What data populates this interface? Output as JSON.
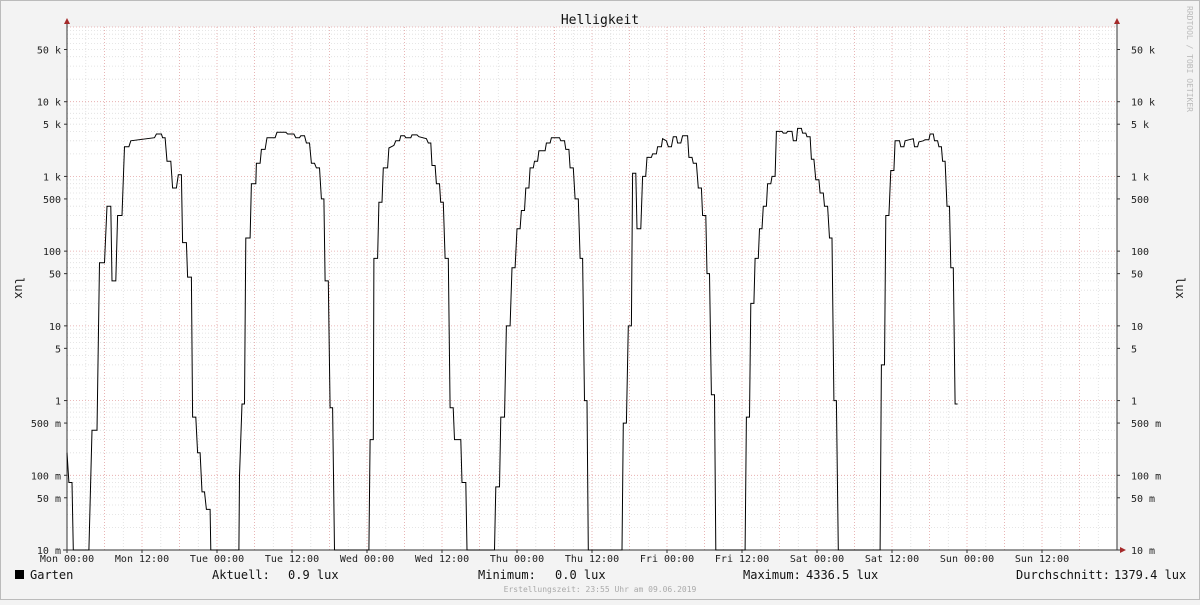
{
  "chart_data": {
    "type": "line",
    "title": "Helligkeit",
    "ylabel": "lux",
    "y_scale": "log",
    "ylim": [
      0.01,
      100000
    ],
    "xlim": [
      0,
      168
    ],
    "x_unit": "hours since Mon 00:00",
    "x_ticks": [
      {
        "x": 0,
        "label": "Mon 00:00"
      },
      {
        "x": 12,
        "label": "Mon 12:00"
      },
      {
        "x": 24,
        "label": "Tue 00:00"
      },
      {
        "x": 36,
        "label": "Tue 12:00"
      },
      {
        "x": 48,
        "label": "Wed 00:00"
      },
      {
        "x": 60,
        "label": "Wed 12:00"
      },
      {
        "x": 72,
        "label": "Thu 00:00"
      },
      {
        "x": 84,
        "label": "Thu 12:00"
      },
      {
        "x": 96,
        "label": "Fri 00:00"
      },
      {
        "x": 108,
        "label": "Fri 12:00"
      },
      {
        "x": 120,
        "label": "Sat 00:00"
      },
      {
        "x": 132,
        "label": "Sat 12:00"
      },
      {
        "x": 144,
        "label": "Sun 00:00"
      },
      {
        "x": 156,
        "label": "Sun 12:00"
      }
    ],
    "y_ticks": [
      {
        "v": 50000,
        "label": "50 k"
      },
      {
        "v": 10000,
        "label": "10 k"
      },
      {
        "v": 5000,
        "label": "5 k"
      },
      {
        "v": 1000,
        "label": "1 k"
      },
      {
        "v": 500,
        "label": "500"
      },
      {
        "v": 100,
        "label": "100"
      },
      {
        "v": 50,
        "label": "50"
      },
      {
        "v": 10,
        "label": "10"
      },
      {
        "v": 5,
        "label": "5"
      },
      {
        "v": 1,
        "label": "1"
      },
      {
        "v": 0.5,
        "label": "500 m"
      },
      {
        "v": 0.1,
        "label": "100 m"
      },
      {
        "v": 0.05,
        "label": "50 m"
      },
      {
        "v": 0.01,
        "label": "10 m"
      }
    ],
    "grid": true,
    "series": [
      {
        "name": "Garten",
        "color": "#000000",
        "points": [
          [
            0,
            0.2
          ],
          [
            0.3,
            0.08
          ],
          [
            0.8,
            0.08
          ],
          [
            1.0,
            0.01
          ],
          [
            3.5,
            0.01
          ],
          [
            4.0,
            0.4
          ],
          [
            4.8,
            0.4
          ],
          [
            5.2,
            70
          ],
          [
            6.0,
            70
          ],
          [
            6.4,
            400
          ],
          [
            7.0,
            400
          ],
          [
            7.2,
            40
          ],
          [
            7.8,
            40
          ],
          [
            8.1,
            300
          ],
          [
            8.8,
            300
          ],
          [
            9.2,
            2500
          ],
          [
            9.9,
            2500
          ],
          [
            10.2,
            3000
          ],
          [
            14.0,
            3300
          ],
          [
            14.3,
            3700
          ],
          [
            15.1,
            3700
          ],
          [
            15.3,
            3300
          ],
          [
            15.7,
            3300
          ],
          [
            16.0,
            1600
          ],
          [
            16.6,
            1600
          ],
          [
            16.9,
            700
          ],
          [
            17.5,
            700
          ],
          [
            17.8,
            1050
          ],
          [
            18.3,
            1050
          ],
          [
            18.5,
            130
          ],
          [
            19.1,
            130
          ],
          [
            19.3,
            45
          ],
          [
            19.9,
            45
          ],
          [
            20.1,
            0.6
          ],
          [
            20.6,
            0.6
          ],
          [
            20.9,
            0.2
          ],
          [
            21.3,
            0.2
          ],
          [
            21.6,
            0.06
          ],
          [
            22.0,
            0.06
          ],
          [
            22.3,
            0.035
          ],
          [
            22.9,
            0.035
          ],
          [
            23.0,
            0.01
          ],
          [
            27.5,
            0.01
          ],
          [
            27.6,
            0.1
          ],
          [
            28.0,
            0.9
          ],
          [
            28.4,
            0.9
          ],
          [
            28.6,
            150
          ],
          [
            29.3,
            150
          ],
          [
            29.5,
            800
          ],
          [
            30.2,
            800
          ],
          [
            30.3,
            1500
          ],
          [
            30.9,
            1500
          ],
          [
            31.1,
            2300
          ],
          [
            31.7,
            2300
          ],
          [
            32.0,
            3300
          ],
          [
            33.3,
            3300
          ],
          [
            33.6,
            3900
          ],
          [
            35.0,
            3900
          ],
          [
            35.3,
            3700
          ],
          [
            36.3,
            3700
          ],
          [
            36.6,
            3300
          ],
          [
            37.2,
            3300
          ],
          [
            37.4,
            3500
          ],
          [
            38.0,
            3500
          ],
          [
            38.3,
            2800
          ],
          [
            38.8,
            2800
          ],
          [
            39.1,
            1500
          ],
          [
            39.6,
            1500
          ],
          [
            39.9,
            1300
          ],
          [
            40.4,
            1300
          ],
          [
            40.7,
            500
          ],
          [
            41.1,
            500
          ],
          [
            41.3,
            40
          ],
          [
            41.8,
            40
          ],
          [
            42.1,
            0.8
          ],
          [
            42.5,
            0.8
          ],
          [
            42.8,
            0.01
          ],
          [
            48.0,
            0.01
          ],
          [
            48.3,
            0.01
          ],
          [
            48.5,
            0.3
          ],
          [
            49.0,
            0.3
          ],
          [
            49.1,
            80
          ],
          [
            49.7,
            80
          ],
          [
            49.9,
            450
          ],
          [
            50.4,
            450
          ],
          [
            50.6,
            1300
          ],
          [
            51.3,
            1300
          ],
          [
            51.5,
            2400
          ],
          [
            52.3,
            2600
          ],
          [
            52.6,
            3000
          ],
          [
            53.2,
            3000
          ],
          [
            53.4,
            3500
          ],
          [
            54.0,
            3500
          ],
          [
            54.2,
            3300
          ],
          [
            55.0,
            3300
          ],
          [
            55.2,
            3600
          ],
          [
            56.0,
            3600
          ],
          [
            56.3,
            3400
          ],
          [
            57.5,
            3200
          ],
          [
            57.8,
            2800
          ],
          [
            58.2,
            2800
          ],
          [
            58.4,
            1400
          ],
          [
            58.9,
            1400
          ],
          [
            59.1,
            800
          ],
          [
            59.6,
            800
          ],
          [
            59.8,
            450
          ],
          [
            60.2,
            450
          ],
          [
            60.5,
            80
          ],
          [
            61.0,
            80
          ],
          [
            61.3,
            0.8
          ],
          [
            61.8,
            0.8
          ],
          [
            62.0,
            0.3
          ],
          [
            63.0,
            0.3
          ],
          [
            63.2,
            0.08
          ],
          [
            63.8,
            0.08
          ],
          [
            64.0,
            0.01
          ],
          [
            68.4,
            0.01
          ],
          [
            68.6,
            0.07
          ],
          [
            69.2,
            0.07
          ],
          [
            69.4,
            0.6
          ],
          [
            70.0,
            0.6
          ],
          [
            70.3,
            10
          ],
          [
            70.9,
            10
          ],
          [
            71.2,
            60
          ],
          [
            71.7,
            60
          ],
          [
            72.0,
            200
          ],
          [
            72.5,
            200
          ],
          [
            72.7,
            350
          ],
          [
            73.2,
            350
          ],
          [
            73.4,
            700
          ],
          [
            73.9,
            700
          ],
          [
            74.1,
            1300
          ],
          [
            74.6,
            1300
          ],
          [
            74.8,
            1600
          ],
          [
            75.3,
            1600
          ],
          [
            75.5,
            2200
          ],
          [
            76.5,
            2200
          ],
          [
            76.7,
            2800
          ],
          [
            77.3,
            2800
          ],
          [
            77.5,
            3300
          ],
          [
            78.8,
            3300
          ],
          [
            79.0,
            3000
          ],
          [
            79.6,
            3000
          ],
          [
            79.8,
            2300
          ],
          [
            80.3,
            2300
          ],
          [
            80.5,
            1300
          ],
          [
            81.0,
            1300
          ],
          [
            81.3,
            500
          ],
          [
            81.8,
            500
          ],
          [
            82.1,
            80
          ],
          [
            82.5,
            80
          ],
          [
            82.8,
            1
          ],
          [
            83.2,
            1
          ],
          [
            83.4,
            0.01
          ],
          [
            88.8,
            0.01
          ],
          [
            89.0,
            0.5
          ],
          [
            89.5,
            0.5
          ],
          [
            89.8,
            10
          ],
          [
            90.3,
            10
          ],
          [
            90.5,
            1100
          ],
          [
            91.0,
            1100
          ],
          [
            91.2,
            200
          ],
          [
            91.8,
            200
          ],
          [
            92.1,
            1000
          ],
          [
            92.6,
            1000
          ],
          [
            92.8,
            1800
          ],
          [
            93.5,
            1800
          ],
          [
            93.7,
            2000
          ],
          [
            94.3,
            2000
          ],
          [
            94.5,
            2500
          ],
          [
            95.1,
            2500
          ],
          [
            95.3,
            3200
          ],
          [
            95.9,
            3000
          ],
          [
            96.2,
            2500
          ],
          [
            96.7,
            2500
          ],
          [
            97.0,
            3400
          ],
          [
            97.5,
            3400
          ],
          [
            97.7,
            2800
          ],
          [
            98.2,
            2800
          ],
          [
            98.5,
            3500
          ],
          [
            99.3,
            3500
          ],
          [
            99.5,
            1800
          ],
          [
            100.0,
            1800
          ],
          [
            100.2,
            1500
          ],
          [
            100.7,
            1500
          ],
          [
            101.0,
            700
          ],
          [
            101.5,
            700
          ],
          [
            101.7,
            300
          ],
          [
            102.2,
            300
          ],
          [
            102.4,
            50
          ],
          [
            102.8,
            50
          ],
          [
            103.1,
            1.2
          ],
          [
            103.6,
            1.2
          ],
          [
            103.8,
            0.01
          ],
          [
            108.5,
            0.01
          ],
          [
            108.7,
            0.6
          ],
          [
            109.2,
            0.6
          ],
          [
            109.4,
            20
          ],
          [
            109.9,
            20
          ],
          [
            110.1,
            80
          ],
          [
            110.6,
            80
          ],
          [
            110.8,
            200
          ],
          [
            111.2,
            200
          ],
          [
            111.4,
            400
          ],
          [
            111.9,
            400
          ],
          [
            112.1,
            800
          ],
          [
            112.6,
            800
          ],
          [
            112.8,
            1000
          ],
          [
            113.3,
            1000
          ],
          [
            113.5,
            4000
          ],
          [
            114.4,
            4000
          ],
          [
            114.6,
            3800
          ],
          [
            115.1,
            3800
          ],
          [
            115.3,
            4000
          ],
          [
            116.0,
            4000
          ],
          [
            116.2,
            3000
          ],
          [
            116.7,
            3000
          ],
          [
            116.9,
            4400
          ],
          [
            117.5,
            4400
          ],
          [
            117.7,
            3800
          ],
          [
            118.2,
            3800
          ],
          [
            118.4,
            3400
          ],
          [
            118.9,
            3400
          ],
          [
            119.1,
            1700
          ],
          [
            119.5,
            1700
          ],
          [
            119.8,
            900
          ],
          [
            120.3,
            900
          ],
          [
            120.5,
            600
          ],
          [
            121.0,
            600
          ],
          [
            121.2,
            400
          ],
          [
            121.7,
            400
          ],
          [
            122.0,
            150
          ],
          [
            122.4,
            150
          ],
          [
            122.7,
            1
          ],
          [
            123.1,
            1
          ],
          [
            123.4,
            0.01
          ],
          [
            130.1,
            0.01
          ],
          [
            130.3,
            3
          ],
          [
            130.8,
            3
          ],
          [
            131.0,
            300
          ],
          [
            131.5,
            300
          ],
          [
            131.8,
            1200
          ],
          [
            132.3,
            1200
          ],
          [
            132.5,
            3000
          ],
          [
            133.2,
            3000
          ],
          [
            133.4,
            2500
          ],
          [
            133.9,
            2500
          ],
          [
            134.1,
            3000
          ],
          [
            135.4,
            3200
          ],
          [
            135.6,
            2500
          ],
          [
            136.1,
            2500
          ],
          [
            136.3,
            2900
          ],
          [
            137.0,
            3000
          ],
          [
            137.3,
            3100
          ],
          [
            137.9,
            3100
          ],
          [
            138.1,
            3700
          ],
          [
            138.6,
            3700
          ],
          [
            138.8,
            3000
          ],
          [
            139.3,
            3000
          ],
          [
            139.5,
            2500
          ],
          [
            139.9,
            2500
          ],
          [
            140.1,
            1600
          ],
          [
            140.5,
            1600
          ],
          [
            140.8,
            400
          ],
          [
            141.2,
            400
          ],
          [
            141.4,
            60
          ],
          [
            141.8,
            60
          ],
          [
            142.1,
            0.9
          ],
          [
            142.5,
            0.9
          ]
        ]
      }
    ]
  },
  "legend": {
    "series_label": "Garten",
    "aktuell_label": "Aktuell:",
    "aktuell_value": "0.9 lux",
    "minimum_label": "Minimum:",
    "minimum_value": "0.0 lux",
    "maximum_label": "Maximum:",
    "maximum_value": "4336.5 lux",
    "durchschnitt_label": "Durchschnitt:",
    "durchschnitt_value": "1379.4 lux"
  },
  "footer": "Erstellungszeit: 23:55 Uhr am 09.06.2019",
  "watermark": "RRDTOOL / TOBI OETIKER",
  "colors": {
    "background": "#f3f3f3",
    "canvas": "#ffffff",
    "grid_minor": "#dddddd",
    "grid_major": "#e3a3a3",
    "line": "#000000",
    "arrow": "#a52a2a"
  }
}
